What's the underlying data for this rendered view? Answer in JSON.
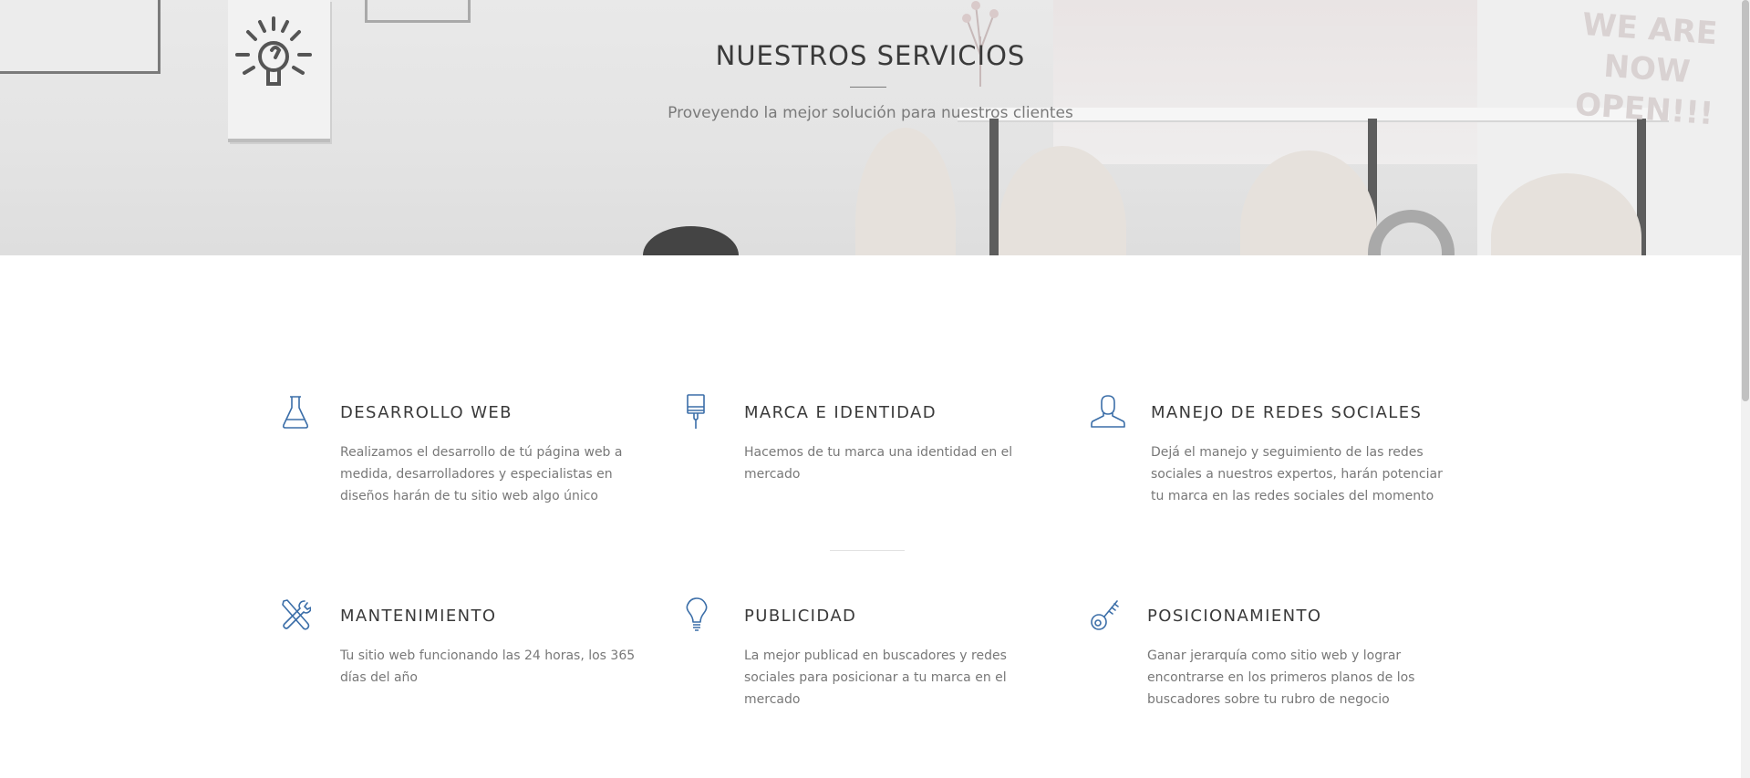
{
  "hero": {
    "title": "NUESTROS SERVICIOS",
    "subtitle": "Proveyendo la mejor solución para nuestros clientes"
  },
  "services": [
    {
      "icon": "flask-icon",
      "title": "DESARROLLO WEB",
      "text": "Realizamos el desarrollo de tú página web a medida, desarrolladores y especialistas en diseños harán de tu sitio web algo único"
    },
    {
      "icon": "paint-brush-icon",
      "title": "MARCA E IDENTIDAD",
      "text": "Hacemos de tu marca una identidad en el mercado"
    },
    {
      "icon": "user-icon",
      "title": "MANEJO DE REDES SOCIALES",
      "text": "Dejá el manejo y seguimiento de las redes sociales a nuestros expertos, harán potenciar tu marca en las redes sociales del momento"
    },
    {
      "icon": "tools-icon",
      "title": "MANTENIMIENTO",
      "text": "Tu sitio web funcionando las 24 horas, los 365 días del año"
    },
    {
      "icon": "lightbulb-icon",
      "title": "PUBLICIDAD",
      "text": "La mejor publicad en buscadores y redes sociales para posicionar a tu marca en el mercado"
    },
    {
      "icon": "key-icon",
      "title": "POSICIONAMIENTO",
      "text": "Ganar jerarquía como sitio web y lograr encontrarse en los primeros planos de los buscadores sobre tu rubro de negocio"
    }
  ],
  "colors": {
    "icon": "#3b6ea8",
    "heading": "#3a3a3a",
    "body_text": "#787878"
  }
}
